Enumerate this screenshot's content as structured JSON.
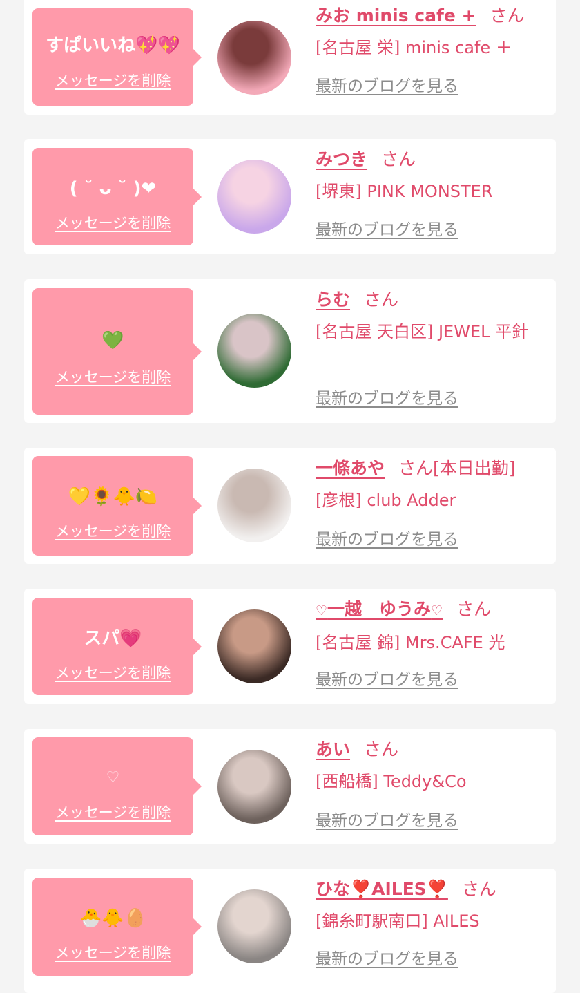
{
  "colors": {
    "page_background": "#f4f4f4",
    "card_background": "#ffffff",
    "bubble_pink": "#ff9aaa",
    "accent_pink": "#e04a6a",
    "link_gray": "#8c8c8c"
  },
  "delete_label": "メッセージを削除",
  "blog_label": "最新のブログを見る",
  "san_label": "さん",
  "items": [
    {
      "message": "すぱいいね💖💖",
      "cast_name": "みお minis cafe +",
      "status": "",
      "shop": "[名古屋 栄] minis cafe ＋",
      "avatar_icon": "photo-avatar",
      "avatar_colors": [
        "#f3a9b8",
        "#7a3b3b"
      ]
    },
    {
      "message": "( ˘ ᴗ ˘ )❤",
      "cast_name": "みつき",
      "status": "",
      "shop": "[堺東] PINK MONSTER",
      "avatar_icon": "photo-avatar",
      "avatar_colors": [
        "#c9a7ea",
        "#f6d3e3"
      ]
    },
    {
      "message": "💚",
      "cast_name": "らむ",
      "status": "",
      "shop": "[名古屋 天白区] JEWEL 平針",
      "avatar_icon": "photo-avatar",
      "avatar_colors": [
        "#2f6b34",
        "#d9c4c7"
      ]
    },
    {
      "message": "💛🌻🐥🍋",
      "cast_name": "一條あや",
      "status": "[本日出勤]",
      "shop": "[彦根] club Adder",
      "avatar_icon": "photo-avatar",
      "avatar_colors": [
        "#f2f0ef",
        "#c9b9b2"
      ]
    },
    {
      "message": "スパ💗",
      "cast_name_prefix": "♡",
      "cast_name": "一越　ゆうみ",
      "cast_name_suffix": "♡",
      "status": "",
      "shop": "[名古屋 錦] Mrs.CAFE 光",
      "avatar_icon": "photo-avatar",
      "avatar_colors": [
        "#3b2a25",
        "#c89a86"
      ]
    },
    {
      "message": "♡",
      "cast_name": "あい",
      "status": "",
      "shop": "[西船橋] Teddy&Co",
      "avatar_icon": "photo-avatar",
      "avatar_colors": [
        "#6d615c",
        "#d9c8c2"
      ]
    },
    {
      "message": "🐣🐥🥚",
      "cast_name": "ひな❣️AILES❣️",
      "status": "",
      "shop": "[錦糸町駅南口] AILES",
      "avatar_icon": "photo-avatar",
      "avatar_colors": [
        "#8a8583",
        "#e3d5cf"
      ]
    }
  ]
}
